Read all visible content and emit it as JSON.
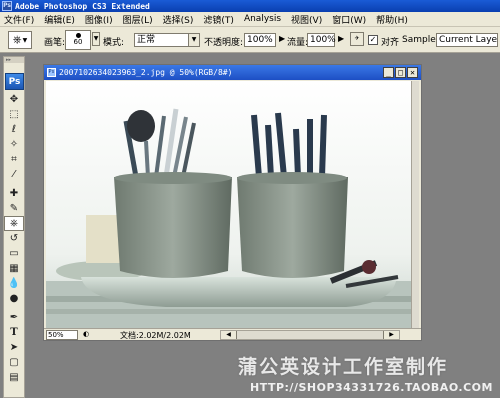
{
  "app": {
    "logo_text": "Ps",
    "title": "Adobe Photoshop CS3 Extended"
  },
  "menu": [
    "文件(F)",
    "编辑(E)",
    "图像(I)",
    "图层(L)",
    "选择(S)",
    "滤镜(T)",
    "Analysis",
    "视图(V)",
    "窗口(W)",
    "帮助(H)"
  ],
  "options": {
    "brush_label": "画笔:",
    "brush_size": "60",
    "mode_label": "模式:",
    "mode_value": "正常",
    "opacity_label": "不透明度:",
    "opacity_value": "100%",
    "flow_label": "流量:",
    "flow_value": "100%",
    "align_label": "对齐",
    "align_checked": "✓",
    "sample_label": "Sample:",
    "sample_value": "Current Layer"
  },
  "document": {
    "title": "20071026340239​63_2.jpg @ 50%(RGB/8#)",
    "zoom": "50%",
    "doc_size": "文档:2.02M/2.02M"
  },
  "watermark": {
    "text": "蒲公英设计工作室制作",
    "url": "HTTP://SHOP34331726.TAOBAO.COM"
  }
}
